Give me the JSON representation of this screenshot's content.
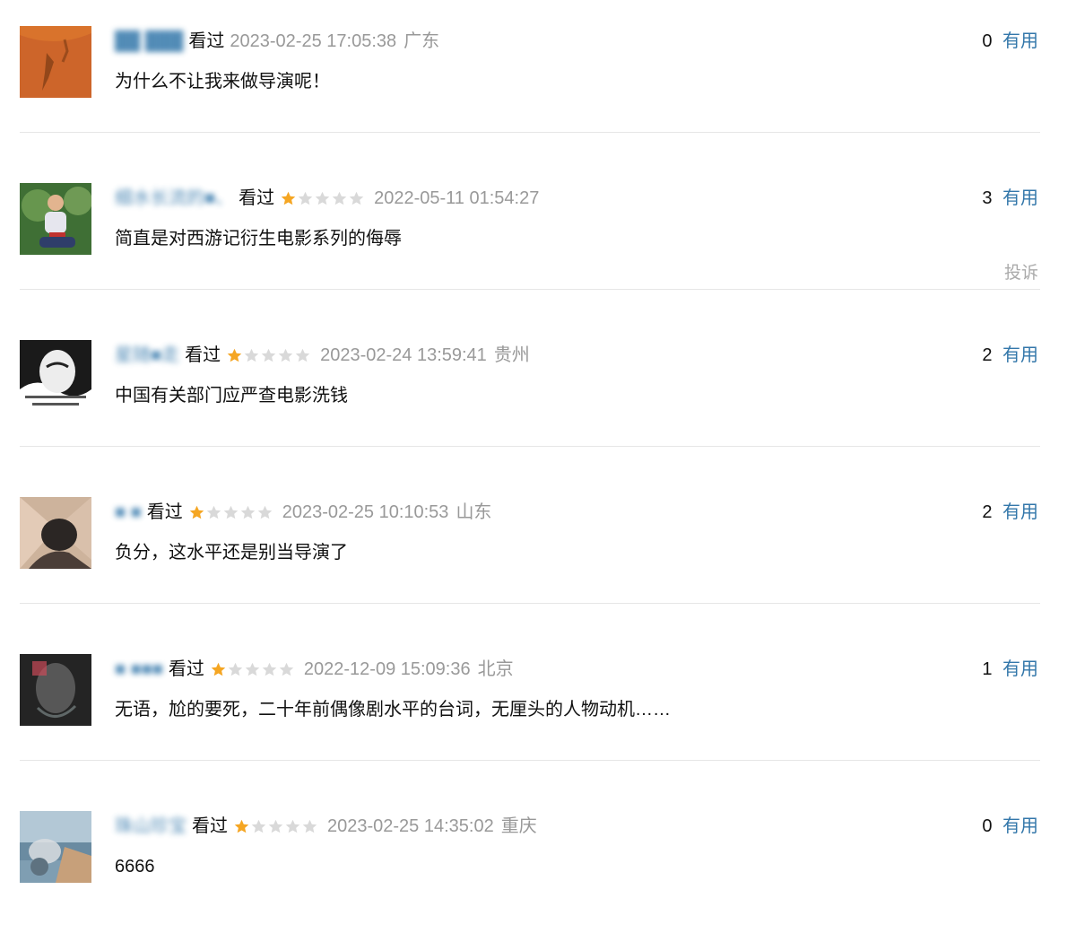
{
  "colors": {
    "link": "#3377aa",
    "meta_gray": "#999999",
    "star_filled": "#f5a623",
    "star_empty": "#d9d9d9",
    "divider": "#e6e6e6"
  },
  "comments": [
    {
      "username": "██ ███",
      "watched_label": "看过",
      "rating": null,
      "max_rating": 5,
      "time": "2023-02-25 17:05:38",
      "region": "广东",
      "votes": "0",
      "vote_label": "有用",
      "content": "为什么不让我来做导演呢！",
      "avatar": {
        "theme": "orange-sand",
        "bg": "#d9732c",
        "fg": "#7a3a14"
      },
      "report_label": null
    },
    {
      "username": "细水长流的■、",
      "watched_label": "看过",
      "rating": 1,
      "max_rating": 5,
      "time": "2022-05-11 01:54:27",
      "region": null,
      "votes": "3",
      "vote_label": "有用",
      "content": "简直是对西游记衍生电影系列的侮辱",
      "avatar": {
        "theme": "green-person",
        "bg": "#5c8a46",
        "fg": "#c0322f"
      },
      "report_label": "投诉"
    },
    {
      "username": "星随■走",
      "watched_label": "看过",
      "rating": 1,
      "max_rating": 5,
      "time": "2023-02-24 13:59:41",
      "region": "贵州",
      "votes": "2",
      "vote_label": "有用",
      "content": "中国有关部门应严查电影洗钱",
      "avatar": {
        "theme": "bw-meme",
        "bg": "#1a1a1a",
        "fg": "#f2f2f2"
      },
      "report_label": null
    },
    {
      "username": "■ ■",
      "watched_label": "看过",
      "rating": 1,
      "max_rating": 5,
      "time": "2023-02-25 10:10:53",
      "region": "山东",
      "votes": "2",
      "vote_label": "有用",
      "content": "负分，这水平还是别当导演了",
      "avatar": {
        "theme": "beige-figure",
        "bg": "#cdb39c",
        "fg": "#2b2624"
      },
      "report_label": null
    },
    {
      "username": "■ ■■■",
      "watched_label": "看过",
      "rating": 1,
      "max_rating": 5,
      "time": "2022-12-09 15:09:36",
      "region": "北京",
      "votes": "1",
      "vote_label": "有用",
      "content": "无语，尬的要死，二十年前偶像剧水平的台词，无厘头的人物动机……",
      "avatar": {
        "theme": "dark-blur",
        "bg": "#2b2b2b",
        "fg": "#6e6e6e"
      },
      "report_label": null
    },
    {
      "username": "珠山珍宝",
      "watched_label": "看过",
      "rating": 1,
      "max_rating": 5,
      "time": "2023-02-25 14:35:02",
      "region": "重庆",
      "votes": "0",
      "vote_label": "有用",
      "content": "6666",
      "avatar": {
        "theme": "sea-sky",
        "bg": "#7f9eb2",
        "fg": "#c7a07a"
      },
      "report_label": null
    }
  ]
}
